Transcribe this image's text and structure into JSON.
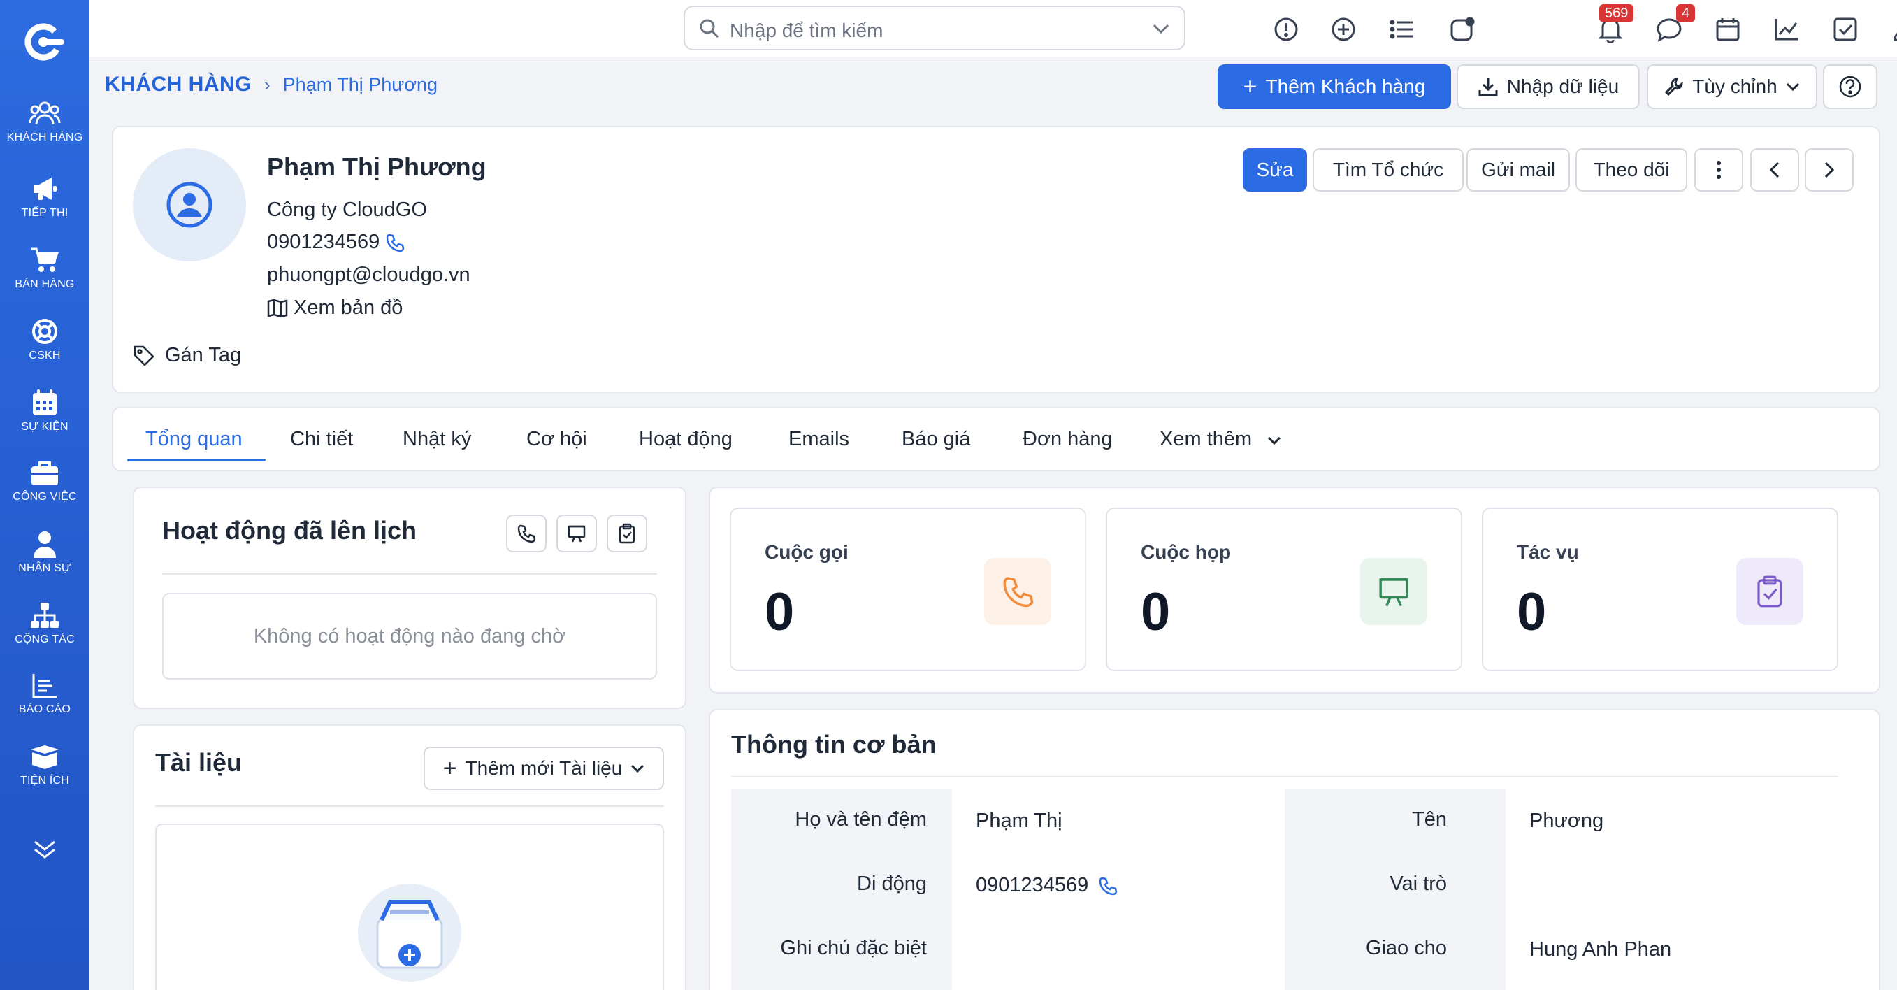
{
  "sidebar": {
    "items": [
      {
        "label": "KHÁCH HÀNG",
        "icon": "users-icon"
      },
      {
        "label": "TIẾP THỊ",
        "icon": "megaphone-icon"
      },
      {
        "label": "BÁN HÀNG",
        "icon": "cart-icon"
      },
      {
        "label": "CSKH",
        "icon": "lifebuoy-icon"
      },
      {
        "label": "SỰ KIỆN",
        "icon": "calendar-icon"
      },
      {
        "label": "CÔNG VIỆC",
        "icon": "briefcase-icon"
      },
      {
        "label": "NHÂN SỰ",
        "icon": "person-icon"
      },
      {
        "label": "CỘNG TÁC",
        "icon": "org-chart-icon"
      },
      {
        "label": "BÁO CÁO",
        "icon": "report-icon"
      },
      {
        "label": "TIỆN ÍCH",
        "icon": "box-icon"
      }
    ]
  },
  "topbar": {
    "search_placeholder": "Nhập để tìm kiếm",
    "notification_count": "569",
    "message_count": "4"
  },
  "breadcrumb": {
    "root": "KHÁCH HÀNG",
    "current": "Phạm Thị Phương"
  },
  "actions": {
    "add_customer": "Thêm Khách hàng",
    "import": "Nhập dữ liệu",
    "customize": "Tùy chỉnh"
  },
  "profile": {
    "name": "Phạm Thị Phương",
    "company": "Công ty CloudGO",
    "phone": "0901234569",
    "email": "phuongpt@cloudgo.vn",
    "map_link": "Xem bản đồ",
    "tag_label": "Gán Tag",
    "buttons": {
      "edit": "Sửa",
      "find_org": "Tìm Tổ chức",
      "send_mail": "Gửi mail",
      "follow": "Theo dõi"
    }
  },
  "tabs": [
    {
      "label": "Tổng quan",
      "active": true
    },
    {
      "label": "Chi tiết"
    },
    {
      "label": "Nhật ký"
    },
    {
      "label": "Cơ hội"
    },
    {
      "label": "Hoạt động"
    },
    {
      "label": "Emails"
    },
    {
      "label": "Báo giá"
    },
    {
      "label": "Đơn hàng"
    },
    {
      "label": "Xem thêm"
    }
  ],
  "scheduled": {
    "title": "Hoạt động đã lên lịch",
    "empty": "Không có hoạt động nào đang chờ"
  },
  "documents": {
    "title": "Tài liệu",
    "add_button": "Thêm mới Tài liệu"
  },
  "stats": [
    {
      "label": "Cuộc gọi",
      "value": "0",
      "icon": "phone-icon",
      "color": "#f28c3a",
      "bg": "#fdf0e6"
    },
    {
      "label": "Cuộc họp",
      "value": "0",
      "icon": "presentation-board-icon",
      "color": "#2f8a55",
      "bg": "#e8f4ec"
    },
    {
      "label": "Tác vụ",
      "value": "0",
      "icon": "clipboard-check-icon",
      "color": "#7c5cc9",
      "bg": "#efeafa"
    }
  ],
  "basic_info": {
    "title": "Thông tin cơ bản",
    "rows": [
      {
        "left_label": "Họ và tên đệm",
        "left_value": "Phạm Thị",
        "right_label": "Tên",
        "right_value": "Phương"
      },
      {
        "left_label": "Di động",
        "left_value": "0901234569",
        "right_label": "Vai trò",
        "right_value": ""
      },
      {
        "left_label": "Ghi chú đặc biệt",
        "left_value": "",
        "right_label": "Giao cho",
        "right_value": "Hung Anh Phan"
      }
    ]
  },
  "colors": {
    "primary": "#2b6be4",
    "sidebar": "#2558cc",
    "badge": "#d93535"
  }
}
